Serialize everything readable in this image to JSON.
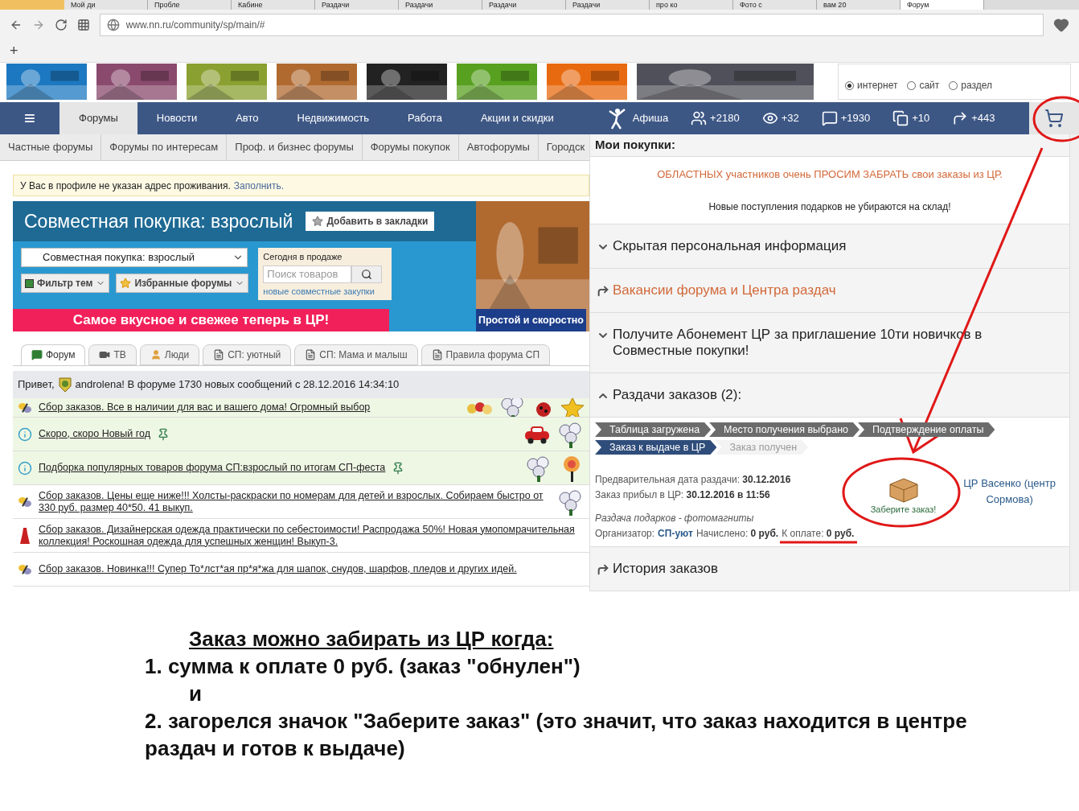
{
  "browser": {
    "tabs": [
      {
        "label": "Мой ди",
        "selected": false
      },
      {
        "label": "Пробле",
        "selected": false
      },
      {
        "label": "Кабине",
        "selected": false
      },
      {
        "label": "Раздачи",
        "selected": false
      },
      {
        "label": "Раздачи",
        "selected": false
      },
      {
        "label": "Раздачи",
        "selected": false
      },
      {
        "label": "Раздачи",
        "selected": false
      },
      {
        "label": "про ко",
        "selected": false
      },
      {
        "label": "Фото с",
        "selected": false
      },
      {
        "label": "вам 20",
        "selected": false
      },
      {
        "label": "Форум",
        "selected": true
      }
    ],
    "url": "www.nn.ru/community/sp/main/#",
    "new_tab": "+"
  },
  "ads": {
    "search_scope": [
      {
        "label": "интернет",
        "selected": true
      },
      {
        "label": "сайт",
        "selected": false
      },
      {
        "label": "раздел",
        "selected": false
      }
    ]
  },
  "nav": {
    "menu_icon": "≡",
    "items": [
      {
        "label": "Форумы",
        "selected": true
      },
      {
        "label": "Новости",
        "selected": false
      },
      {
        "label": "Авто",
        "selected": false
      },
      {
        "label": "Недвижимость",
        "selected": false
      },
      {
        "label": "Работа",
        "selected": false
      },
      {
        "label": "Акции и скидки",
        "selected": false
      }
    ],
    "afisha": "Афиша",
    "stats": [
      {
        "kind": "people",
        "value": "+2180"
      },
      {
        "kind": "eye",
        "value": "+32"
      },
      {
        "kind": "comment",
        "value": "+1930"
      },
      {
        "kind": "squares",
        "value": "+10"
      },
      {
        "kind": "arrow",
        "value": "+443"
      }
    ]
  },
  "subnav": [
    "Частные форумы",
    "Форумы по интересам",
    "Проф. и бизнес форумы",
    "Форумы покупок",
    "Автофорумы",
    "Городск"
  ],
  "notice": {
    "text": "У Вас в профиле не указан адрес проживания.",
    "link": "Заполнить."
  },
  "forum_header": {
    "title": "Совместная покупка: взрослый",
    "bookmark_button": "Добавить в закладки",
    "forum_select": "Совместная покупка: взрослый",
    "filter_button": "Фильтр тем",
    "favorites_button": "Избранные форумы",
    "today_label": "Сегодня в продаже",
    "search_placeholder": "Поиск товаров",
    "new_purchases_link": "новые совместные закупки",
    "promo": "Самое вкусное и свежее теперь в ЦР!",
    "ad_caption": "Простой и скоростно"
  },
  "forum_tabs": [
    {
      "kind": "comment",
      "label": "Форум",
      "selected": true
    },
    {
      "kind": "video",
      "label": "ТВ",
      "selected": false
    },
    {
      "kind": "person",
      "label": "Люди",
      "selected": false
    },
    {
      "kind": "doc",
      "label": "СП: уютный",
      "selected": false
    },
    {
      "kind": "doc",
      "label": "СП: Мама и малыш",
      "selected": false
    },
    {
      "kind": "doc",
      "label": "Правила форума СП",
      "selected": false
    }
  ],
  "greeting": {
    "hello": "Привет,",
    "text": "androlena! В форуме 1730 новых сообщений с 28.12.2016 14:34:10"
  },
  "threads": [
    {
      "kind": "butterfly",
      "title": "Сбор заказов. Все в наличии для вас и вашего дома! Огромный выбор",
      "pinned": false,
      "highlighted": true,
      "decor": [
        {
          "kind": "bouquet"
        },
        {
          "kind": "flower"
        },
        {
          "kind": "ladybug"
        },
        {
          "kind": "star"
        }
      ]
    },
    {
      "kind": "info",
      "title": "Скоро, скоро Новый год",
      "pinned": true,
      "highlighted": true,
      "decor": [
        {
          "kind": "car"
        },
        {
          "kind": "flower"
        }
      ]
    },
    {
      "kind": "info",
      "title": "Подборка популярных товаров форума СП:взрослый по итогам СП-феста",
      "pinned": true,
      "highlighted": true,
      "decor": [
        {
          "kind": "flower"
        },
        {
          "kind": "rose"
        }
      ]
    },
    {
      "kind": "butterfly",
      "title": "Сбор заказов. Цены еще ниже!!! Холсты-раскраски по номерам для детей и взрослых. Собираем быстро от 330 руб. размер 40*50. 41 выкуп.",
      "pinned": false,
      "highlighted": false,
      "decor": [
        {
          "kind": "flower"
        }
      ]
    },
    {
      "kind": "dress",
      "title": "Сбор заказов. Дизайнерская одежда практически по себестоимости! Распродажа 50%! Новая умопомрачительная коллекция! Роскошная одежда для успешных женщин! Выкуп-3.",
      "pinned": false,
      "highlighted": false
    },
    {
      "kind": "butterfly",
      "title": "Сбор заказов. Новинка!!! Супер То*лст*ая пр*я*жа для шапок, снудов, шарфов, пледов и других идей.",
      "pinned": false,
      "highlighted": false
    }
  ],
  "purchases": {
    "title": "Мои покупки:",
    "notice_orange": "ОБЛАСТНЫХ участников очень ПРОСИМ ЗАБРАТЬ свои заказы из ЦР.",
    "notice": "Новые поступления подарков не убираются на склад!",
    "sections": [
      {
        "kind": "toggle",
        "label": "Скрытая персональная информация",
        "expanded": false,
        "orange": false
      },
      {
        "kind": "link",
        "label": "Вакансии форума и Центра раздач",
        "orange": true
      },
      {
        "kind": "toggle",
        "label": "Получите Абонемент ЦР за приглашение 10ти новичков в Совместные покупки!",
        "expanded": false,
        "orange": false
      },
      {
        "kind": "toggle",
        "label": "Раздачи заказов (2):",
        "expanded": true,
        "orange": false
      }
    ],
    "steps": [
      {
        "label": "Таблица загружена",
        "kind": "done"
      },
      {
        "label": "Место получения выбрано",
        "kind": "done"
      },
      {
        "label": "Подтверждение оплаты",
        "kind": "done"
      },
      {
        "label": "Заказ к выдаче в ЦР",
        "kind": "current"
      },
      {
        "label": "Заказ получен",
        "kind": "pending"
      }
    ],
    "order": {
      "date_label": "Предварительная дата раздачи:",
      "date": "30.12.2016",
      "arrived_label": "Заказ прибыл в ЦР:",
      "arrived": "30.12.2016 в 11:56",
      "purchase_name": "Раздача подарков - фотомагниты",
      "organizer_label": "Организатор:",
      "organizer": "СП-уют",
      "charged_label": "Начислено:",
      "charged": "0 руб.",
      "due_label": "К оплате:",
      "due": "0 руб.",
      "pickup_button": "Заберите заказ!",
      "pickup_point": "ЦР Васенко (центр Сормова)"
    },
    "history": {
      "kind": "link",
      "label": "История заказов",
      "orange": false
    }
  },
  "instructions": {
    "title": "Заказ можно забирать из ЦР когда:",
    "lines": [
      {
        "kind": "item",
        "text": "1. сумма к оплате 0 руб. (заказ \"обнулен\")"
      },
      {
        "kind": "joiner",
        "text": "и"
      },
      {
        "kind": "item",
        "text": "2. загорелся значок \"Заберите заказ\" (это значит, что заказ находится в центре раздач и готов к выдаче)"
      }
    ]
  }
}
